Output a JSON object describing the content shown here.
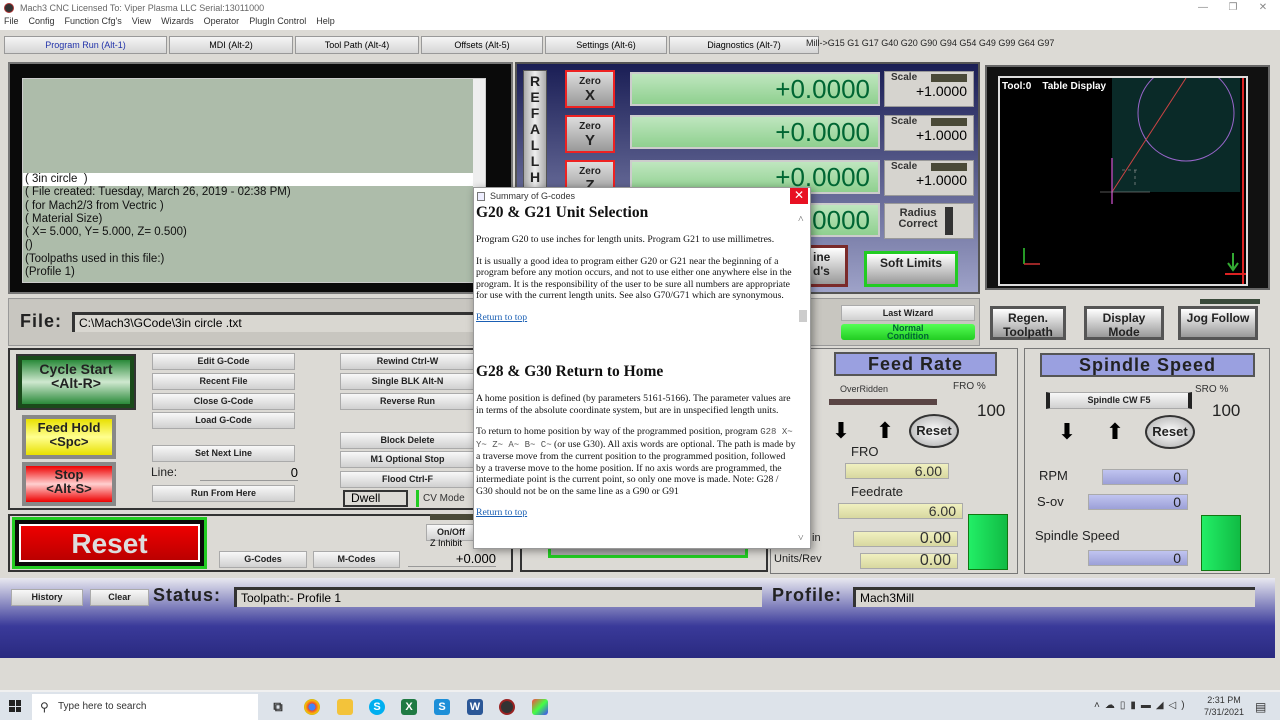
{
  "window": {
    "title": "Mach3 CNC  Licensed To: Viper Plasma LLC Serial:13011000",
    "controls": {
      "minimize": "—",
      "maximize": "❐",
      "close": "✕"
    }
  },
  "menu": [
    "File",
    "Config",
    "Function Cfg's",
    "View",
    "Wizards",
    "Operator",
    "PlugIn Control",
    "Help"
  ],
  "tabs": [
    {
      "label": "Program Run (Alt-1)",
      "active": true
    },
    {
      "label": "MDI (Alt-2)"
    },
    {
      "label": "Tool Path (Alt-4)"
    },
    {
      "label": "Offsets (Alt-5)"
    },
    {
      "label": "Settings (Alt-6)"
    },
    {
      "label": "Diagnostics (Alt-7)"
    }
  ],
  "modal_line": "Mill->G15  G1 G17 G40 G20 G90 G94 G54 G49 G99 G64 G97",
  "gcode": {
    "lines": [
      "( 3in circle  )",
      "( File created: Tuesday, March 26, 2019 - 02:38 PM)",
      "( for Mach2/3 from Vectric )",
      "( Material Size)",
      "( X= 5.000, Y= 5.000, Z= 0.500)",
      "()",
      "(Toolpaths used in this file:)",
      "(Profile 1)"
    ]
  },
  "dro": {
    "ref_all_home": "REFALLH",
    "axes": [
      {
        "zero_label": "Zero",
        "axis": "X",
        "value": "+0.0000",
        "scale_label": "Scale",
        "scale": "+1.0000"
      },
      {
        "zero_label": "Zero",
        "axis": "Y",
        "value": "+0.0000",
        "scale_label": "Scale",
        "scale": "+1.0000"
      },
      {
        "zero_label": "Zero",
        "axis": "Z",
        "value": "+0.0000",
        "scale_label": "Scale",
        "scale": "+1.0000"
      },
      {
        "value": "0000"
      }
    ],
    "radius_correct": "Radius Correct",
    "machine_coords": "ine\nd's",
    "soft_limits": "Soft Limits",
    "last_wizard": "Last Wizard",
    "normal_condition": "Normal Condition"
  },
  "toolpath": {
    "label": "Tool:0    Table Display",
    "buttons": [
      "Regen. Toolpath",
      "Display Mode",
      "Jog Follow"
    ]
  },
  "file": {
    "label": "File:",
    "path": "C:\\Mach3\\GCode\\3in circle .txt"
  },
  "controls": {
    "cycle_start": "Cycle Start\n<Alt-R>",
    "feed_hold": "Feed Hold\n<Spc>",
    "stop": "Stop\n<Alt-S>",
    "edit_gcode": "Edit G-Code",
    "recent_file": "Recent File",
    "close_gcode": "Close G-Code",
    "load_gcode": "Load G-Code",
    "set_next_line": "Set Next Line",
    "line_label": "Line:",
    "line_value": "0",
    "run_from_here": "Run From Here",
    "rewind": "Rewind Ctrl-W",
    "single_blk": "Single BLK Alt-N",
    "reverse_run": "Reverse Run",
    "block_delete": "Block Delete",
    "m1_optional_stop": "M1 Optional Stop",
    "flood": "Flood Ctrl-F",
    "dwell": "Dwell",
    "cv_mode": "CV Mode",
    "reset": "Reset",
    "gcodes": "G-Codes",
    "mcodes": "M-Codes",
    "on_off": "On/Off",
    "z_inhibit": "Z Inhibit",
    "z_inhibit_value": "+0.000"
  },
  "feed": {
    "title": "Feed Rate",
    "overridden": "OverRidden",
    "fro_pct_label": "FRO %",
    "fro_pct": "100",
    "reset": "Reset",
    "fro_label": "FRO",
    "fro_value": "6.00",
    "feedrate_label": "Feedrate",
    "feedrate_value": "6.00",
    "units_min_label": "in",
    "units_min_value": "0.00",
    "units_rev_label": "Units/Rev",
    "units_rev_value": "0.00"
  },
  "spindle": {
    "title": "Spindle Speed",
    "cw_button": "Spindle CW F5",
    "sro_pct_label": "SRO %",
    "sro_pct": "100",
    "reset": "Reset",
    "rpm_label": "RPM",
    "rpm_value": "0",
    "sov_label": "S-ov",
    "sov_value": "0",
    "speed_label": "Spindle Speed",
    "speed_value": "0"
  },
  "status": {
    "history": "History",
    "clear": "Clear",
    "label": "Status:",
    "text": "Toolpath:- Profile 1",
    "profile_label": "Profile:",
    "profile": "Mach3Mill"
  },
  "dialog": {
    "title": "Summary of G-codes",
    "sections": [
      {
        "heading": "G20 & G21 Unit Selection",
        "p1": "Program G20 to use inches for length units. Program G21 to use millimetres.",
        "p2": "It is usually a good idea to program either G20 or G21 near the beginning of a program before any motion occurs, and not to use either one anywhere else in the program. It is the responsibility of the user to be sure all numbers are appropriate for use with the current length units. See also G70/G71 which are synonymous.",
        "link": "Return to top"
      },
      {
        "heading": "G28 & G30 Return to Home",
        "p1": "A home position is defined (by parameters 5161-5166). The parameter values are in terms of the absolute coordinate system, but are in unspecified length units.",
        "p2a": "To return to home position by way of the programmed position, program",
        "p2code": "G28 X~ Y~ Z~ A~ B~ C~",
        "p2b": "(or use G30). All axis words are optional. The path is made by a traverse move from the current position to the programmed position, followed by a traverse move to the home position. If no axis words are programmed, the intermediate point is the current point, so only one move is made. Note: G28 / G30 should not be on the same line as a G90 or G91",
        "link": "Return to top"
      }
    ]
  },
  "taskbar": {
    "search_placeholder": "Type here to search",
    "time": "2:31 PM",
    "date": "7/31/2021"
  }
}
